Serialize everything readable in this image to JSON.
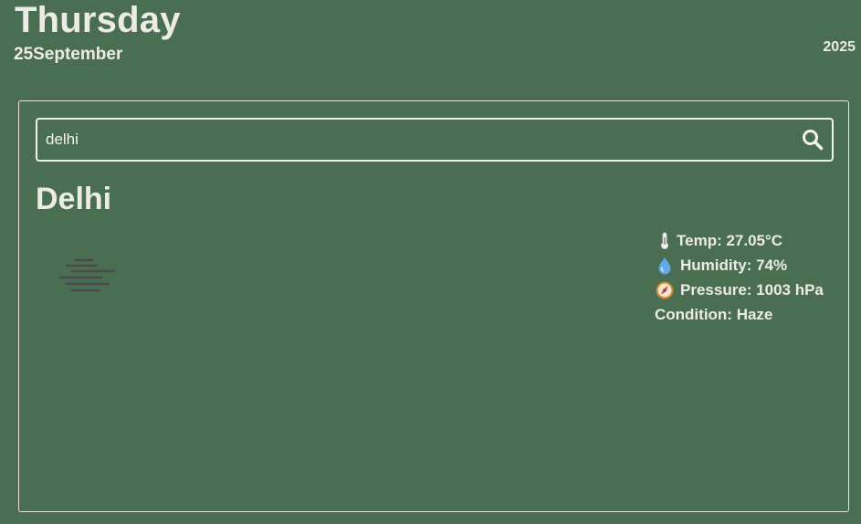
{
  "header": {
    "day": "Thursday",
    "date": "25September",
    "year": "2025"
  },
  "search": {
    "value": "delhi",
    "icon": "search-icon"
  },
  "weather": {
    "city": "Delhi",
    "icon": "haze-icon",
    "temp_label": "Temp: 27.05°C",
    "humidity_label": "Humidity: 74%",
    "pressure_label": "Pressure: 1003 hPa",
    "condition_label": "Condition: Haze"
  },
  "colors": {
    "background": "#4a6e51",
    "text": "#ecebe6",
    "border": "#e6e6e0"
  }
}
